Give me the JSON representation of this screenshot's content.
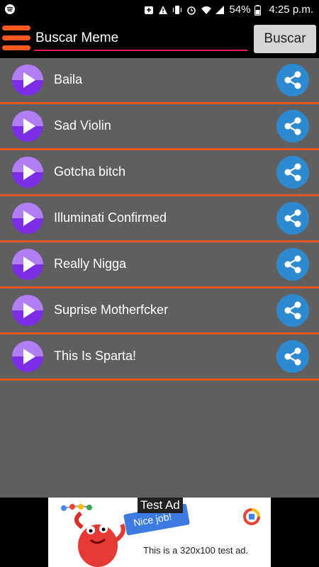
{
  "status_bar": {
    "battery_percent": "54%",
    "time": "4:25 p.m.",
    "icons": [
      "spotify-icon",
      "sync-icon",
      "warning-icon",
      "vibrate-icon",
      "alarm-icon",
      "wifi-icon",
      "signal-icon",
      "battery-icon"
    ]
  },
  "toolbar": {
    "search_placeholder": "Buscar Meme",
    "search_button": "Buscar",
    "menu_icon": "hamburger-icon"
  },
  "list": {
    "items": [
      {
        "label": "Baila"
      },
      {
        "label": "Sad Violin"
      },
      {
        "label": "Gotcha bitch"
      },
      {
        "label": "Illuminati Confirmed"
      },
      {
        "label": "Really Nigga"
      },
      {
        "label": "Suprise Motherfcker"
      },
      {
        "label": "This Is Sparta!"
      }
    ],
    "play_icon": "play-icon",
    "share_icon": "share-icon"
  },
  "ad": {
    "badge": "Test Ad",
    "text": "This is a 320x100 test ad.",
    "chip": "Nice job!"
  },
  "colors": {
    "accent": "#e2551f",
    "share_blue": "#2d8ad1",
    "play_purple": "#7b2ee6",
    "list_bg": "#5f5f5f",
    "input_underline": "#e91e63"
  }
}
